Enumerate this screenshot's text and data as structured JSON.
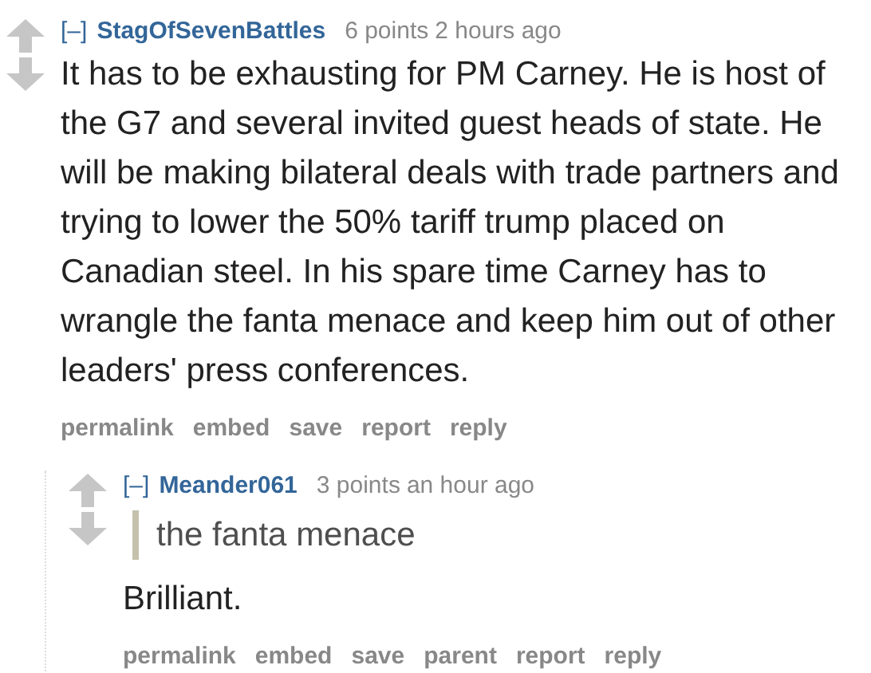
{
  "comments": [
    {
      "collapse": "[–]",
      "author": "StagOfSevenBattles",
      "score": "6 points",
      "time": "2 hours ago",
      "body": "It has to be exhausting for PM Carney. He is host of the G7 and several invited guest heads of state. He will be making bilateral deals with trade partners and trying to lower the 50% tariff trump placed on Canadian steel. In his spare time Carney has to wrangle the fanta menace and keep him out of other leaders' press conferences.",
      "actions": [
        "permalink",
        "embed",
        "save",
        "report",
        "reply"
      ],
      "children": [
        {
          "collapse": "[–]",
          "author": "Meander061",
          "score": "3 points",
          "time": "an hour ago",
          "quote": "the fanta menace",
          "body": "Brilliant.",
          "actions": [
            "permalink",
            "embed",
            "save",
            "parent",
            "report",
            "reply"
          ]
        }
      ]
    }
  ]
}
